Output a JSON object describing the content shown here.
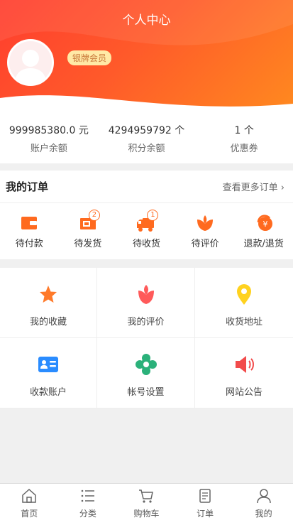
{
  "header": {
    "title": "个人中心",
    "badge": "银牌会员"
  },
  "stats": [
    {
      "value": "999985380.0 元",
      "label": "账户余额"
    },
    {
      "value": "4294959792 个",
      "label": "积分余额"
    },
    {
      "value": "1 个",
      "label": "优惠券"
    }
  ],
  "orders": {
    "title": "我的订单",
    "more": "查看更多订单 ›",
    "items": [
      {
        "label": "待付款",
        "icon": "wallet-icon"
      },
      {
        "label": "待发货",
        "icon": "package-icon",
        "count": "2"
      },
      {
        "label": "待收货",
        "icon": "truck-icon",
        "count": "1"
      },
      {
        "label": "待评价",
        "icon": "flower-icon"
      },
      {
        "label": "退款/退货",
        "icon": "refund-icon"
      }
    ]
  },
  "menu": [
    {
      "label": "我的收藏",
      "icon": "star-icon"
    },
    {
      "label": "我的评价",
      "icon": "tulip-icon"
    },
    {
      "label": "收货地址",
      "icon": "location-pin-icon"
    },
    {
      "label": "收款账户",
      "icon": "id-card-icon"
    },
    {
      "label": "帐号设置",
      "icon": "settings-flower-icon"
    },
    {
      "label": "网站公告",
      "icon": "megaphone-icon"
    }
  ],
  "tabbar": [
    {
      "label": "首页",
      "icon": "home-icon"
    },
    {
      "label": "分类",
      "icon": "list-icon"
    },
    {
      "label": "购物车",
      "icon": "cart-icon"
    },
    {
      "label": "订单",
      "icon": "order-icon"
    },
    {
      "label": "我的",
      "icon": "user-icon"
    }
  ],
  "colors": {
    "brand_start": "#ff3d2e",
    "brand_end": "#ff8a1f",
    "accent_orange": "#ff6a1f"
  }
}
